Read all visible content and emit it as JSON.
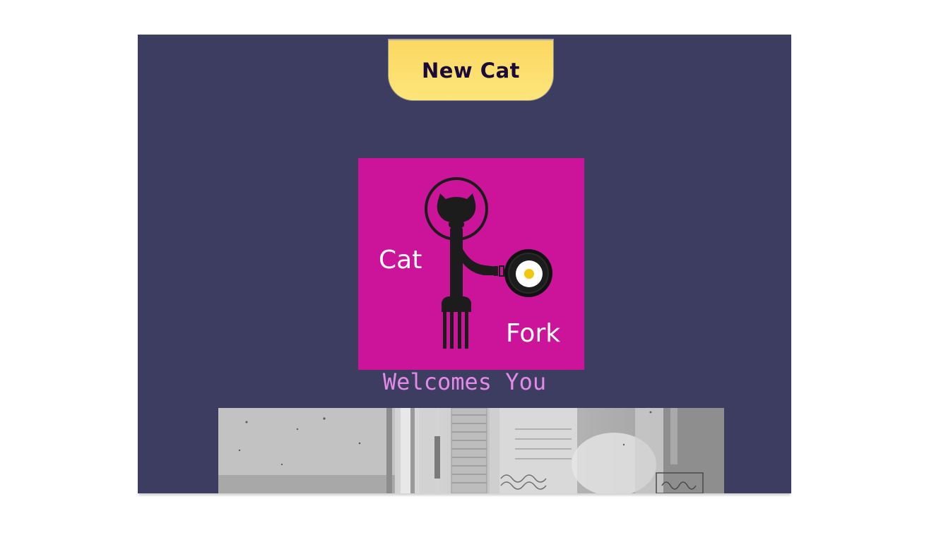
{
  "header": {
    "new_cat_label": "New Cat"
  },
  "logo": {
    "word_top": "Cat",
    "word_bottom": "Fork",
    "background_color": "#cc149b"
  },
  "tagline": "Welcomes You",
  "colors": {
    "page_background": "#3d3d62",
    "button_fill": "#fde06e",
    "button_text": "#1a0a3a",
    "tagline_text": "#e48ae6"
  },
  "icons": {
    "logo_figure": "cat-with-fork-and-frying-pan-icon"
  }
}
